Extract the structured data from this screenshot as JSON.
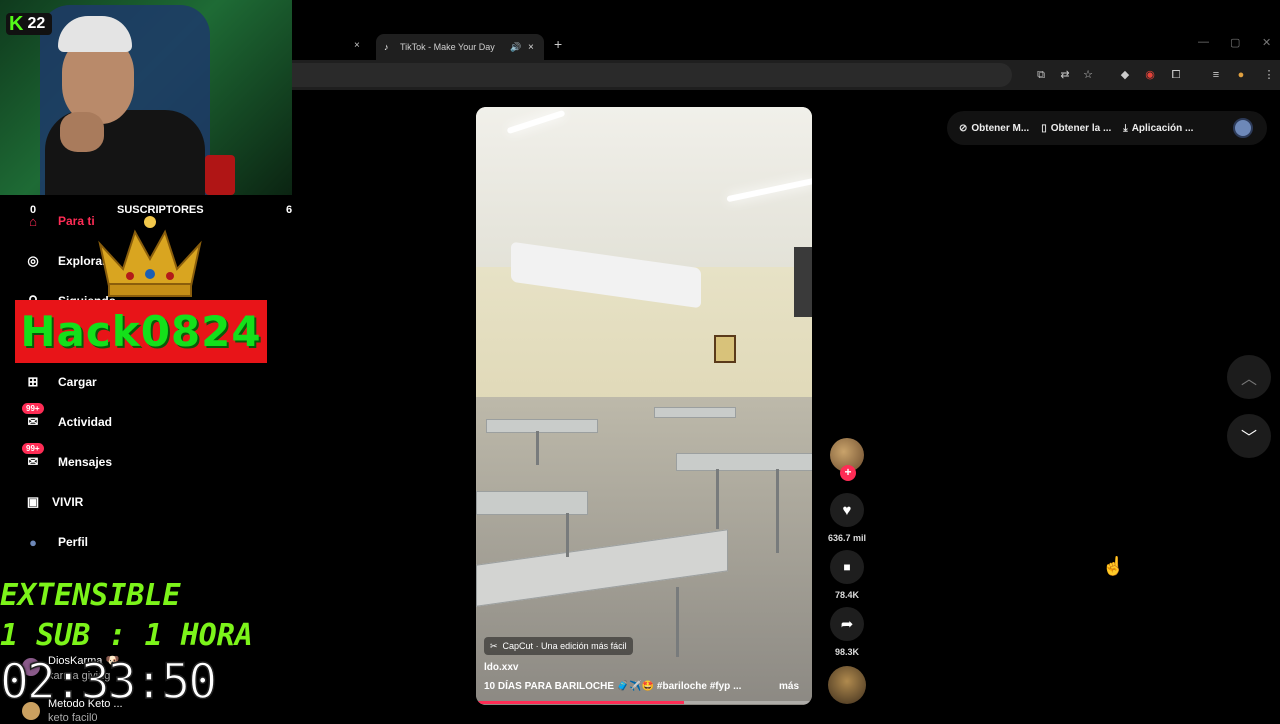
{
  "browser": {
    "tab_active_title": "TikTok - Make Your Day",
    "tab_close": "×",
    "new_tab": "+",
    "favicon": "♪",
    "speaker": "🔊"
  },
  "window_controls": {
    "minimize": "—",
    "maximize": "▢",
    "close": "✕"
  },
  "toolbar_icons": [
    "cast-icon",
    "translate-icon",
    "bookmark-star-icon",
    "extension-diamond-icon",
    "extension-shield-icon",
    "extensions-puzzle-icon",
    "media-control-icon",
    "profile-icon",
    "menu-kebab-icon"
  ],
  "download_bar": {
    "items": [
      {
        "icon": "⊘",
        "label": "Obtener M..."
      },
      {
        "icon": "▯",
        "label": "Obtener la ..."
      },
      {
        "icon": "⤓",
        "label": "Aplicación ..."
      }
    ]
  },
  "video": {
    "capcut_label": "CapCut · Una edición más fácil",
    "capcut_icon": "✂",
    "author": "ldo.xxv",
    "caption": "10 DÍAS PARA BARILOCHE 🧳✈️🤩 #bariloche #fyp ...",
    "more": "más",
    "progress": 0.62
  },
  "actions": {
    "follow_plus": "+",
    "like_icon": "♥",
    "like_count": "636.7 mil",
    "save_icon": "■",
    "save_count": "78.4K",
    "share_icon": "➦",
    "share_count": "98.3K"
  },
  "nav_arrows": {
    "up": "︿",
    "down": "﹀"
  },
  "webcam": {
    "kick_k": "K",
    "kick_count": "22"
  },
  "sidebar_nav": [
    {
      "icon": "⌂",
      "label": "Para ti"
    },
    {
      "icon": "◎",
      "label": "Explorar"
    },
    {
      "icon": "⚲",
      "label": "Siguiendo"
    },
    {
      "icon": "⊞",
      "label": "Cargar"
    },
    {
      "icon": "✉",
      "label": "Actividad",
      "badge": "99+"
    },
    {
      "icon": "✉",
      "label": "Mensajes",
      "badge": "99+"
    },
    {
      "icon": "▣",
      "label": "VIVIR"
    },
    {
      "icon": "●",
      "label": "Perfil"
    }
  ],
  "overlay": {
    "sub_left": "0",
    "sub_title": "SUSCRIPTORES",
    "sub_right": "6",
    "hack_name": "Hack0824",
    "ext_line1": "EXTENSIBLE",
    "ext_line2": "1 SUB : 1 HORA",
    "timer": "02:33:50"
  },
  "chat": [
    {
      "user": "DiosKarma 🐶",
      "text": "karma giving"
    },
    {
      "user": "Metodo Keto ...",
      "text": "keto facil0"
    }
  ],
  "cursor_icon": "☝",
  "colors": {
    "accent": "#fe2c55",
    "kick_green": "#53fc18",
    "hack_red": "#e81418",
    "hack_green": "#14e01a",
    "ext_green": "#7cf41a"
  }
}
